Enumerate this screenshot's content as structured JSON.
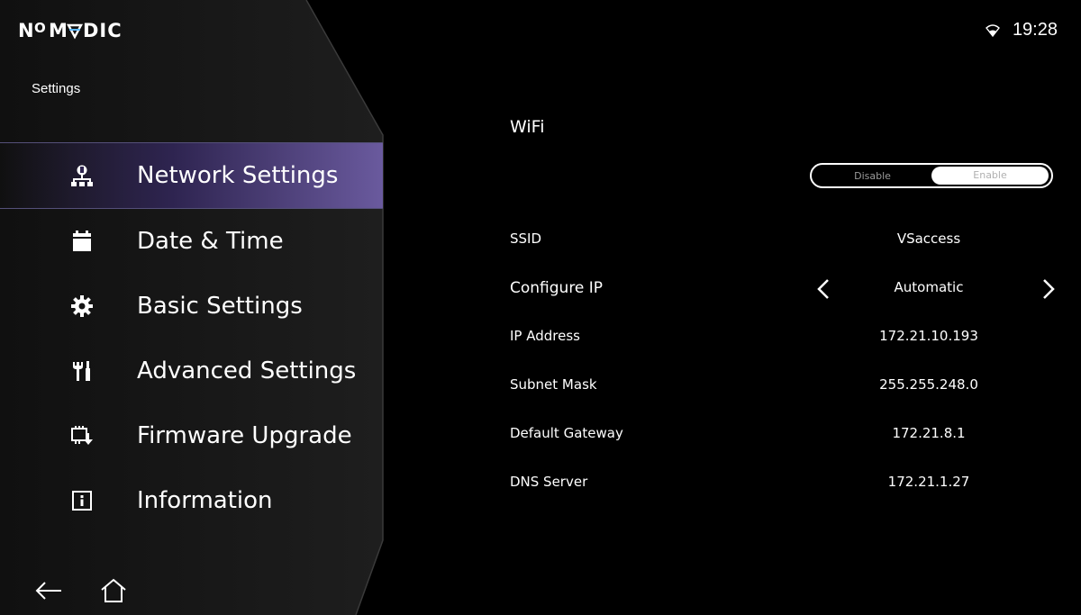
{
  "brand": {
    "logo_text": "NOMVDIC"
  },
  "status": {
    "time": "19:28",
    "icon": "wifi-icon"
  },
  "sidebar": {
    "title": "Settings",
    "items": [
      {
        "label": "Network Settings",
        "icon": "network-icon",
        "active": true
      },
      {
        "label": "Date & Time",
        "icon": "calendar-icon"
      },
      {
        "label": "Basic Settings",
        "icon": "gear-icon"
      },
      {
        "label": "Advanced Settings",
        "icon": "tools-icon"
      },
      {
        "label": "Firmware Upgrade",
        "icon": "firmware-icon"
      },
      {
        "label": "Information",
        "icon": "info-icon"
      }
    ],
    "bottom": [
      "back-arrow-icon",
      "home-icon"
    ]
  },
  "main": {
    "section_title": "WiFi",
    "toggle": {
      "off_label": "Disable",
      "on_label": "Enable",
      "selected": "Enable"
    },
    "fields": [
      {
        "label": "SSID",
        "value": "VSaccess"
      },
      {
        "label": "Configure IP",
        "value": "Automatic"
      },
      {
        "label": "IP Address",
        "value": "172.21.10.193"
      },
      {
        "label": "Subnet Mask",
        "value": "255.255.248.0"
      },
      {
        "label": "Default Gateway",
        "value": "172.21.8.1"
      },
      {
        "label": "DNS Server",
        "value": "172.21.1.27"
      }
    ]
  },
  "colors": {
    "background": "#000000",
    "active_item": "#6a5a9e",
    "text": "#ffffff"
  }
}
